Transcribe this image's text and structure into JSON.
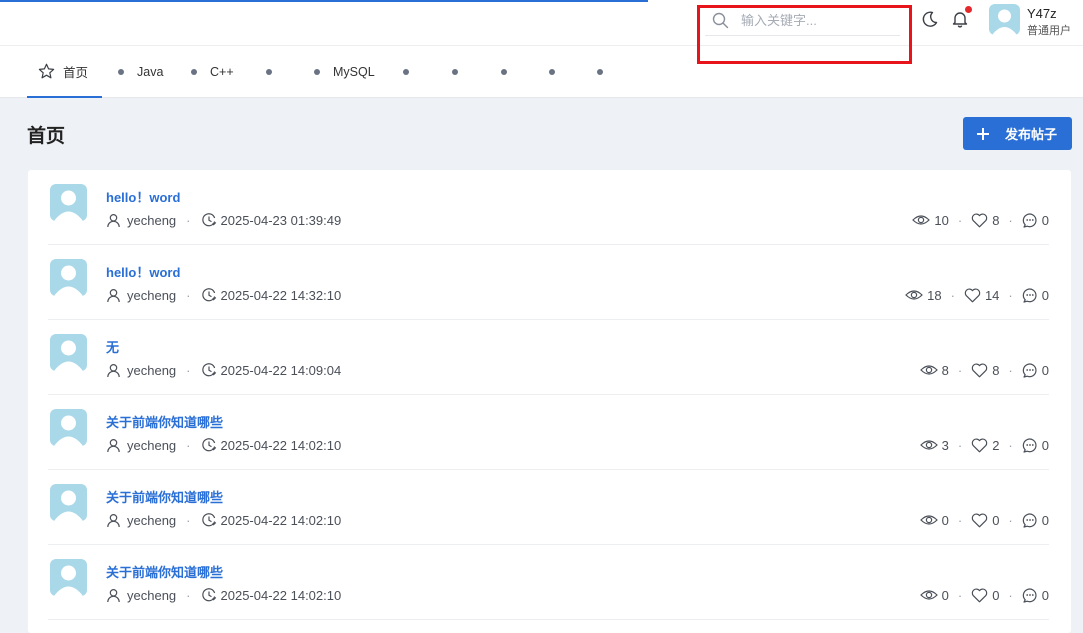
{
  "header": {
    "search": {
      "placeholder": "输入关键字...",
      "value": ""
    },
    "icons": [
      "search-icon",
      "moon-icon",
      "bell-icon"
    ],
    "notification_dot": true,
    "user": {
      "name": "Y47z",
      "role": "普通用户"
    }
  },
  "tabs": [
    {
      "label": "首页",
      "icon": "star-icon",
      "active": true
    },
    {
      "label": "Java"
    },
    {
      "label": "C++"
    },
    {
      "label": ""
    },
    {
      "label": "MySQL"
    },
    {
      "label": ""
    },
    {
      "label": ""
    },
    {
      "label": ""
    },
    {
      "label": ""
    },
    {
      "label": ""
    }
  ],
  "main": {
    "title": "首页",
    "publish_button": "发布帖子"
  },
  "posts": [
    {
      "title": "hello！word",
      "author": "yecheng",
      "date": "2025-04-23 01:39:49",
      "views": "10",
      "likes": "8",
      "comments": "0"
    },
    {
      "title": "hello！word",
      "author": "yecheng",
      "date": "2025-04-22 14:32:10",
      "views": "18",
      "likes": "14",
      "comments": "0"
    },
    {
      "title": "无",
      "author": "yecheng",
      "date": "2025-04-22 14:09:04",
      "views": "8",
      "likes": "8",
      "comments": "0"
    },
    {
      "title": "关于前端你知道哪些",
      "author": "yecheng",
      "date": "2025-04-22 14:02:10",
      "views": "3",
      "likes": "2",
      "comments": "0"
    },
    {
      "title": "关于前端你知道哪些",
      "author": "yecheng",
      "date": "2025-04-22 14:02:10",
      "views": "0",
      "likes": "0",
      "comments": "0"
    },
    {
      "title": "关于前端你知道哪些",
      "author": "yecheng",
      "date": "2025-04-22 14:02:10",
      "views": "0",
      "likes": "0",
      "comments": "0"
    }
  ],
  "meta_separator": "·",
  "colors": {
    "accent": "#2a6fd6",
    "highlight": "#e8141b",
    "avatar": "#a9d8e8",
    "page_bg": "#eef1f6"
  }
}
